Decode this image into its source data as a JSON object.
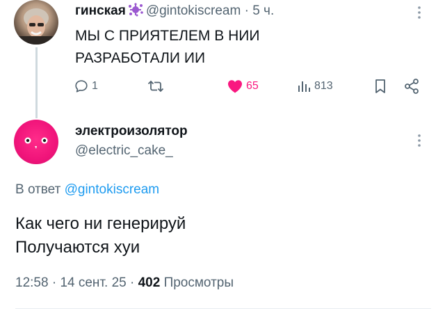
{
  "parent_tweet": {
    "display_name": "гинская",
    "badge_icon": "splat-badge-icon",
    "handle": "@gintokiscream",
    "separator": "·",
    "time": "5 ч.",
    "text_line1": "МЫ С ПРИЯТЕЛЕМ В НИИ",
    "text_line2": "РАЗРАБОТАЛИ ИИ",
    "actions": {
      "reply_count": "1",
      "retweet_count": "",
      "like_count": "65",
      "views_count": "813"
    }
  },
  "reply_tweet": {
    "display_name": "электроизолятор",
    "handle": "@electric_cake_",
    "replying_prefix": "В ответ",
    "replying_mention": "@gintokiscream",
    "text_line1": "Как чего ни генерируй",
    "text_line2": "Получаются хуи",
    "time": "12:58",
    "sep1": "·",
    "date": "14 сент. 25",
    "sep2": "·",
    "views_count": "402",
    "views_label": "Просмотры"
  },
  "colors": {
    "text": "#0f1419",
    "secondary": "#536471",
    "link": "#1d9bf0",
    "like": "#f91880",
    "thread_line": "#cfd9de",
    "badge": "#9b59d0"
  }
}
